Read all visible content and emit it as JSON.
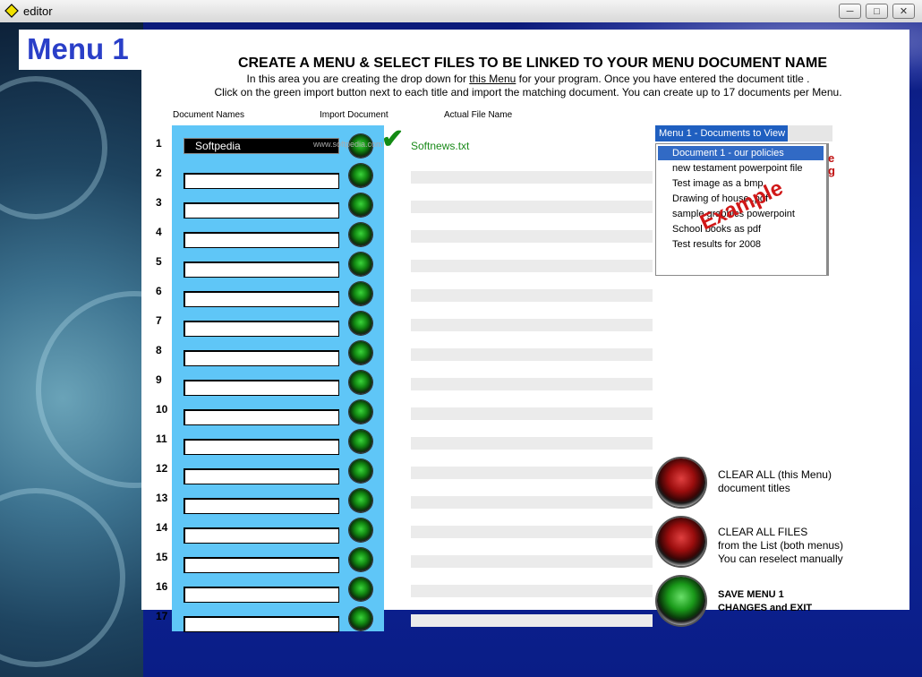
{
  "window": {
    "title": "editor"
  },
  "header": {
    "menu_title": "Menu 1",
    "heading": "CREATE A MENU & SELECT FILES TO BE LINKED TO YOUR MENU DOCUMENT NAME",
    "instr1_before": "In this area you are creating the drop down for ",
    "instr1_link": "this Menu",
    "instr1_after": " for your program. Once you have entered the document title .",
    "instr2": "Click on the green import button next to each title and import the matching document. You can create up to 17 documents per Menu."
  },
  "columns": {
    "names": "Document Names",
    "import": "Import Document",
    "actual": "Actual File Name"
  },
  "rows": [
    {
      "num": "1",
      "name": "Softpedia",
      "file": "Softnews.txt"
    },
    {
      "num": "2",
      "name": "",
      "file": ""
    },
    {
      "num": "3",
      "name": "",
      "file": ""
    },
    {
      "num": "4",
      "name": "",
      "file": ""
    },
    {
      "num": "5",
      "name": "",
      "file": ""
    },
    {
      "num": "6",
      "name": "",
      "file": ""
    },
    {
      "num": "7",
      "name": "",
      "file": ""
    },
    {
      "num": "8",
      "name": "",
      "file": ""
    },
    {
      "num": "9",
      "name": "",
      "file": ""
    },
    {
      "num": "10",
      "name": "",
      "file": ""
    },
    {
      "num": "11",
      "name": "",
      "file": ""
    },
    {
      "num": "12",
      "name": "",
      "file": ""
    },
    {
      "num": "13",
      "name": "",
      "file": ""
    },
    {
      "num": "14",
      "name": "",
      "file": ""
    },
    {
      "num": "15",
      "name": "",
      "file": ""
    },
    {
      "num": "16",
      "name": "",
      "file": ""
    },
    {
      "num": "17",
      "name": "",
      "file": ""
    }
  ],
  "watermark": "www.softpedia.com",
  "dropdown": {
    "header": "Menu 1 - Documents to View",
    "items": [
      "Document 1  - our policies",
      "new testament powerpoint file",
      "Test image as a bmp",
      "Drawing of house .pdf",
      "sample graphics powerpoint",
      "School books as pdf",
      "Test results for 2008"
    ],
    "selected_index": 0,
    "overlay": "Example"
  },
  "buttons": {
    "clear_all_line1": "CLEAR ALL  (this Menu)",
    "clear_all_line2": "document titles",
    "clear_files_line1": "CLEAR ALL FILES",
    "clear_files_line2": "from the List (both menus)",
    "clear_files_line3": "You can reselect manually",
    "save_line1": "SAVE MENU 1",
    "save_line2": "CHANGES and EXIT"
  },
  "colors": {
    "accent_blue": "#2a3fc8",
    "column_blue": "#5fc6f7",
    "file_green": "#1a8a1a",
    "example_red": "#d01818"
  }
}
